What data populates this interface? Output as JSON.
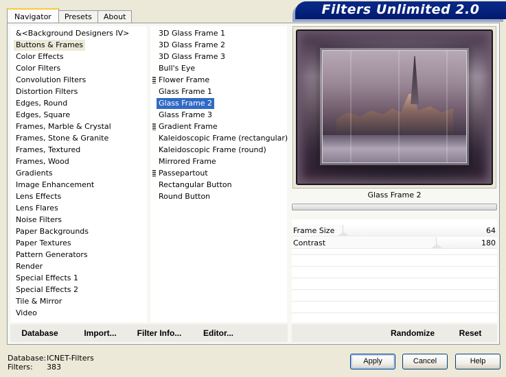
{
  "title": "Filters Unlimited 2.0",
  "tabs": [
    "Navigator",
    "Presets",
    "About"
  ],
  "categories": [
    "&<Background Designers IV>",
    "Buttons & Frames",
    "Color Effects",
    "Color Filters",
    "Convolution Filters",
    "Distortion Filters",
    "Edges, Round",
    "Edges, Square",
    "Frames, Marble & Crystal",
    "Frames, Stone & Granite",
    "Frames, Textured",
    "Frames, Wood",
    "Gradients",
    "Image Enhancement",
    "Lens Effects",
    "Lens Flares",
    "Noise Filters",
    "Paper Backgrounds",
    "Paper Textures",
    "Pattern Generators",
    "Render",
    "Special Effects 1",
    "Special Effects 2",
    "Tile & Mirror",
    "Video"
  ],
  "selected_category": "Buttons & Frames",
  "filters": [
    {
      "label": "3D Glass Frame 1",
      "marked": false
    },
    {
      "label": "3D Glass Frame 2",
      "marked": false
    },
    {
      "label": "3D Glass Frame 3",
      "marked": false
    },
    {
      "label": "Bull's Eye",
      "marked": false
    },
    {
      "label": "Flower Frame",
      "marked": true
    },
    {
      "label": "Glass Frame 1",
      "marked": false
    },
    {
      "label": "Glass Frame 2",
      "marked": false
    },
    {
      "label": "Glass Frame 3",
      "marked": false
    },
    {
      "label": "Gradient Frame",
      "marked": true
    },
    {
      "label": "Kaleidoscopic Frame (rectangular)",
      "marked": false
    },
    {
      "label": "Kaleidoscopic Frame (round)",
      "marked": false
    },
    {
      "label": "Mirrored Frame",
      "marked": false
    },
    {
      "label": "Passepartout",
      "marked": true
    },
    {
      "label": "Rectangular Button",
      "marked": false
    },
    {
      "label": "Round Button",
      "marked": false
    }
  ],
  "selected_filter": "Glass Frame 2",
  "preview": {
    "caption": "Glass Frame 2"
  },
  "params": [
    {
      "label": "Frame Size",
      "value": "64",
      "max": 255
    },
    {
      "label": "Contrast",
      "value": "180",
      "max": 255
    }
  ],
  "commands": {
    "database": "Database",
    "import": "Import...",
    "filter_info": "Filter Info...",
    "editor": "Editor...",
    "randomize": "Randomize",
    "reset": "Reset"
  },
  "footer": {
    "database_label": "Database:",
    "database_value": "ICNET-Filters",
    "filters_label": "Filters:",
    "filters_value": "383"
  },
  "buttons": {
    "apply": "Apply",
    "cancel": "Cancel",
    "help": "Help"
  },
  "colors": {
    "banner": "#001a6e",
    "selection": "#316ac5",
    "dialog_bg": "#ece9d8"
  }
}
